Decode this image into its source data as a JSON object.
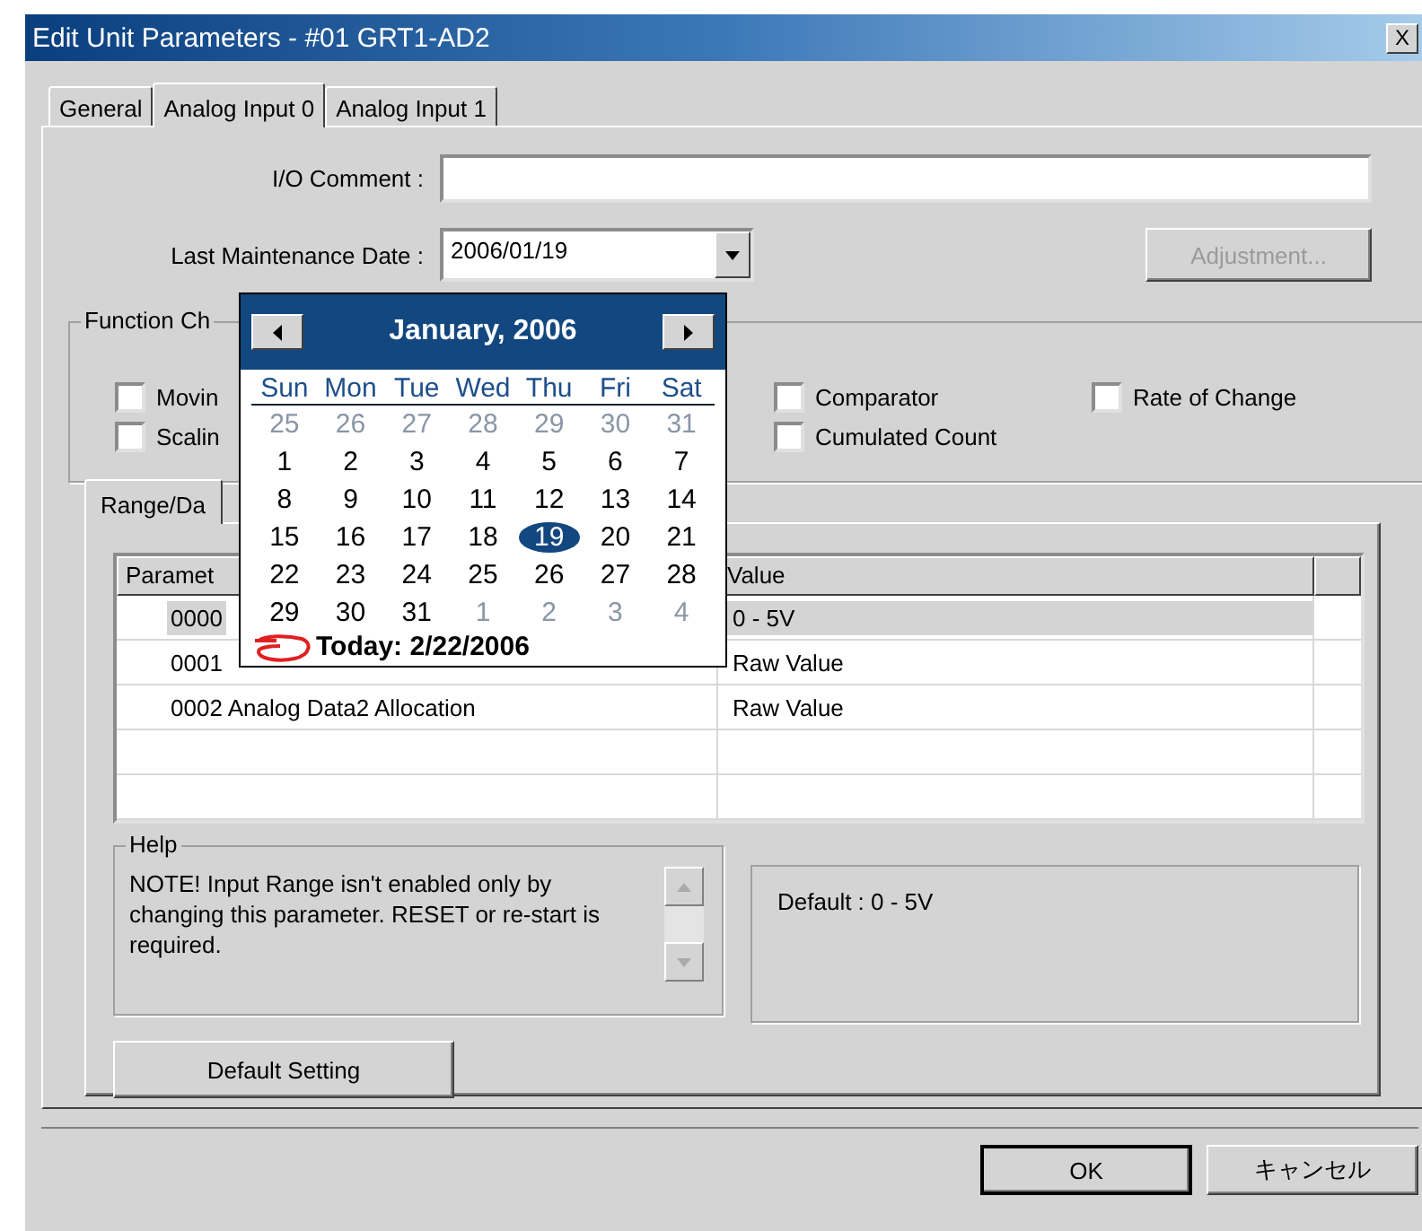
{
  "window": {
    "title": "Edit Unit Parameters - #01 GRT1-AD2",
    "close": "X"
  },
  "tabs": [
    {
      "label": "General",
      "selected": false
    },
    {
      "label": "Analog Input 0",
      "selected": true
    },
    {
      "label": "Analog Input 1",
      "selected": false
    }
  ],
  "io_comment": {
    "label": "I/O Comment :"
  },
  "maintenance_date": {
    "label": "Last Maintenance Date :",
    "value": "2006/01/19"
  },
  "adjustment_button": {
    "label": "Adjustment...",
    "disabled": true
  },
  "function_choice": {
    "title": "Function Ch",
    "rows": [
      [
        {
          "label": "Movin",
          "checked": false
        },
        {
          "label": "Comparator",
          "checked": false
        },
        {
          "label": "Rate of Change",
          "checked": false
        }
      ],
      [
        {
          "label": "Scalin",
          "checked": false
        },
        {
          "label": "Cumulated Count",
          "checked": false
        }
      ]
    ]
  },
  "range_tab": {
    "label": "Range/Da"
  },
  "table": {
    "columns": [
      "Paramet",
      "Value"
    ],
    "rows": [
      {
        "cells": [
          "0000",
          "0 - 5V"
        ],
        "selected": true
      },
      {
        "cells": [
          "0001",
          "Raw Value"
        ],
        "selected": false
      },
      {
        "cells": [
          "0002 Analog Data2 Allocation",
          "Raw Value"
        ],
        "selected": false
      }
    ]
  },
  "help": {
    "title": "Help",
    "text": "NOTE! Input Range isn't enabled only by changing this parameter. RESET or re-start is required."
  },
  "default_info": "Default : 0 - 5V",
  "default_button": "Default Setting",
  "buttons": [
    "OK",
    "キャンセル"
  ],
  "calendar": {
    "month": "January, 2006",
    "weekdays": [
      "Sun",
      "Mon",
      "Tue",
      "Wed",
      "Thu",
      "Fri",
      "Sat"
    ],
    "weeks": [
      [
        {
          "day": "25",
          "other_month": true,
          "selected": false
        },
        {
          "day": "26",
          "other_month": true,
          "selected": false
        },
        {
          "day": "27",
          "other_month": true,
          "selected": false
        },
        {
          "day": "28",
          "other_month": true,
          "selected": false
        },
        {
          "day": "29",
          "other_month": true,
          "selected": false
        },
        {
          "day": "30",
          "other_month": true,
          "selected": false
        },
        {
          "day": "31",
          "other_month": true,
          "selected": false
        }
      ],
      [
        {
          "day": "1",
          "other_month": false,
          "selected": false
        },
        {
          "day": "2",
          "other_month": false,
          "selected": false
        },
        {
          "day": "3",
          "other_month": false,
          "selected": false
        },
        {
          "day": "4",
          "other_month": false,
          "selected": false
        },
        {
          "day": "5",
          "other_month": false,
          "selected": false
        },
        {
          "day": "6",
          "other_month": false,
          "selected": false
        },
        {
          "day": "7",
          "other_month": false,
          "selected": false
        }
      ],
      [
        {
          "day": "8",
          "other_month": false,
          "selected": false
        },
        {
          "day": "9",
          "other_month": false,
          "selected": false
        },
        {
          "day": "10",
          "other_month": false,
          "selected": false
        },
        {
          "day": "11",
          "other_month": false,
          "selected": false
        },
        {
          "day": "12",
          "other_month": false,
          "selected": false
        },
        {
          "day": "13",
          "other_month": false,
          "selected": false
        },
        {
          "day": "14",
          "other_month": false,
          "selected": false
        }
      ],
      [
        {
          "day": "15",
          "other_month": false,
          "selected": false
        },
        {
          "day": "16",
          "other_month": false,
          "selected": false
        },
        {
          "day": "17",
          "other_month": false,
          "selected": false
        },
        {
          "day": "18",
          "other_month": false,
          "selected": false
        },
        {
          "day": "19",
          "other_month": false,
          "selected": true
        },
        {
          "day": "20",
          "other_month": false,
          "selected": false
        },
        {
          "day": "21",
          "other_month": false,
          "selected": false
        }
      ],
      [
        {
          "day": "22",
          "other_month": false,
          "selected": false
        },
        {
          "day": "23",
          "other_month": false,
          "selected": false
        },
        {
          "day": "24",
          "other_month": false,
          "selected": false
        },
        {
          "day": "25",
          "other_month": false,
          "selected": false
        },
        {
          "day": "26",
          "other_month": false,
          "selected": false
        },
        {
          "day": "27",
          "other_month": false,
          "selected": false
        },
        {
          "day": "28",
          "other_month": false,
          "selected": false
        }
      ],
      [
        {
          "day": "29",
          "other_month": false,
          "selected": false
        },
        {
          "day": "30",
          "other_month": false,
          "selected": false
        },
        {
          "day": "31",
          "other_month": false,
          "selected": false
        },
        {
          "day": "1",
          "other_month": true,
          "selected": false
        },
        {
          "day": "2",
          "other_month": true,
          "selected": false
        },
        {
          "day": "3",
          "other_month": true,
          "selected": false
        },
        {
          "day": "4",
          "other_month": true,
          "selected": false
        }
      ]
    ],
    "today": "Today: 2/22/2006"
  }
}
